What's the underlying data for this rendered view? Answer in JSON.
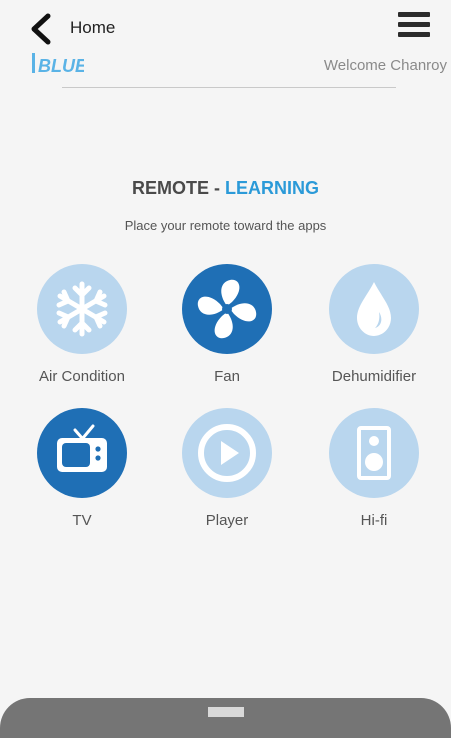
{
  "header": {
    "back_label": "Home",
    "logo_text": "BLUE",
    "welcome": "Welcome Chanroy"
  },
  "main": {
    "title_prefix": "REMOTE - ",
    "title_accent": "LEARNING",
    "subtitle": "Place your remote toward the apps",
    "apps": [
      {
        "label": "Air Condition",
        "icon": "snowflake-icon",
        "active": false
      },
      {
        "label": "Fan",
        "icon": "fan-icon",
        "active": true
      },
      {
        "label": "Dehumidifier",
        "icon": "water-drop-icon",
        "active": false
      },
      {
        "label": "TV",
        "icon": "tv-icon",
        "active": true
      },
      {
        "label": "Player",
        "icon": "play-icon",
        "active": false
      },
      {
        "label": "Hi-fi",
        "icon": "speaker-icon",
        "active": false
      }
    ]
  },
  "colors": {
    "accent": "#2b9ad8",
    "active_circle": "#1f6fb5",
    "inactive_circle": "#b9d6ee",
    "background": "#f5f5f5"
  }
}
